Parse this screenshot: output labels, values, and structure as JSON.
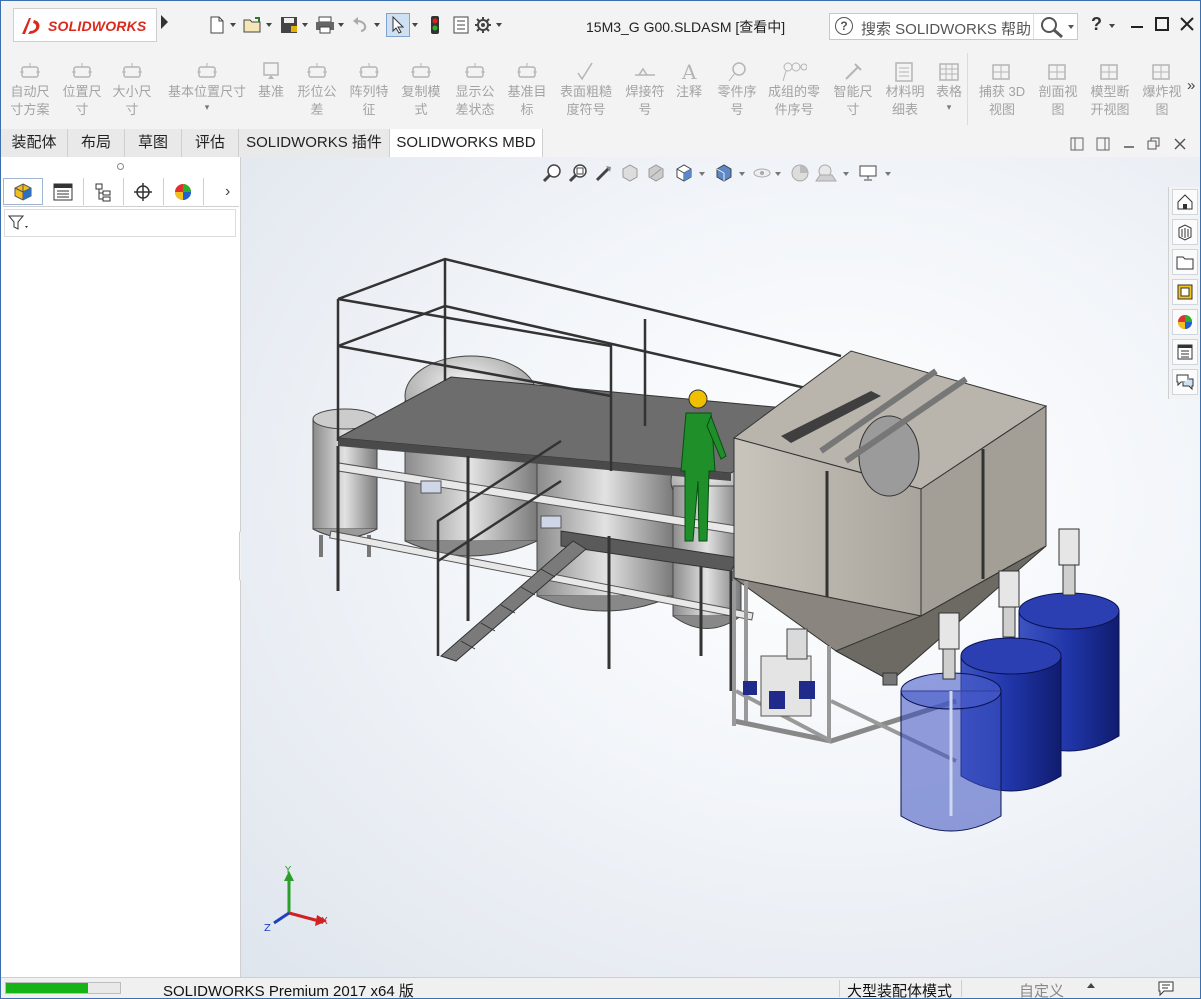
{
  "app": {
    "logo_text": "SOLIDWORKS",
    "document_title": "15M3_G G00.SLDASM [查看中]",
    "search_placeholder": "搜索 SOLIDWORKS 帮助",
    "help_label": "?"
  },
  "quick_access": {
    "icons": [
      "new-document-icon",
      "open-file-icon",
      "save-icon",
      "print-icon",
      "undo-icon",
      "select-pointer-icon",
      "rebuild-traffic-light-icon",
      "file-properties-icon",
      "options-gear-icon"
    ]
  },
  "command_manager": {
    "items": [
      {
        "label": "自动尺\n寸方案",
        "icon": "auto-dimension-icon"
      },
      {
        "label": "位置尺\n寸",
        "icon": "location-dimension-icon"
      },
      {
        "label": "大小尺\n寸",
        "icon": "size-dimension-icon"
      },
      {
        "label": "基本位置尺寸",
        "icon": "basic-location-dimension-icon"
      },
      {
        "label": "基准",
        "icon": "datum-icon"
      },
      {
        "label": "形位公\n差",
        "icon": "geometric-tolerance-icon"
      },
      {
        "label": "阵列特\n征",
        "icon": "pattern-feature-icon"
      },
      {
        "label": "复制模\n式",
        "icon": "copy-scheme-icon"
      },
      {
        "label": "显示公\n差状态",
        "icon": "show-tolerance-status-icon"
      },
      {
        "label": "基准目\n标",
        "icon": "datum-target-icon"
      },
      {
        "label": "表面粗糙\n度符号",
        "icon": "surface-finish-icon"
      },
      {
        "label": "焊接符\n号",
        "icon": "weld-symbol-icon"
      },
      {
        "label": "注释",
        "icon": "note-icon"
      },
      {
        "label": "零件序\n号",
        "icon": "balloon-icon"
      },
      {
        "label": "成组的零\n件序号",
        "icon": "stacked-balloon-icon"
      },
      {
        "label": "智能尺\n寸",
        "icon": "smart-dimension-icon"
      },
      {
        "label": "材料明\n细表",
        "icon": "bill-of-materials-icon"
      },
      {
        "label": "表格",
        "icon": "table-icon"
      },
      {
        "label": "捕获 3D\n视图",
        "icon": "capture-3d-view-icon"
      },
      {
        "label": "剖面视\n图",
        "icon": "section-view-icon"
      },
      {
        "label": "模型断\n开视图",
        "icon": "model-break-view-icon"
      },
      {
        "label": "爆炸视\n图",
        "icon": "explode-view-icon"
      }
    ]
  },
  "tabs": [
    {
      "label": "装配体"
    },
    {
      "label": "布局"
    },
    {
      "label": "草图"
    },
    {
      "label": "评估"
    },
    {
      "label": "SOLIDWORKS 插件"
    },
    {
      "label": "SOLIDWORKS MBD"
    }
  ],
  "feature_manager": {
    "tabs": [
      "featuremanager-tree-icon",
      "propertymanager-icon",
      "configurationmanager-icon",
      "dimxpertmanager-icon",
      "displaymanager-icon"
    ]
  },
  "viewport": {
    "heads_up_toolbar": [
      "zoom-to-fit-icon",
      "zoom-to-area-icon",
      "previous-view-icon",
      "section-view-icon",
      "dynamic-annotation-icon",
      "view-orientation-icon",
      "display-style-icon",
      "hide-show-items-icon",
      "edit-appearance-icon",
      "apply-scene-icon",
      "view-settings-icon"
    ],
    "triad": {
      "x": "X",
      "y": "Y",
      "z": "Z"
    }
  },
  "task_pane": [
    "solidworks-resources-icon",
    "design-library-icon",
    "file-explorer-icon",
    "view-palette-icon",
    "appearances-scenes-icon",
    "custom-properties-icon",
    "forum-icon"
  ],
  "status_bar": {
    "progress": 0.72,
    "product": "SOLIDWORKS Premium 2017 x64 版",
    "mode": "大型装配体模式",
    "units": "自定义"
  },
  "colors": {
    "accent_red": "#da291c",
    "progress_green": "#16b316",
    "tank_blue": "#1d2f9a",
    "operator_green": "#1f8f2a"
  }
}
